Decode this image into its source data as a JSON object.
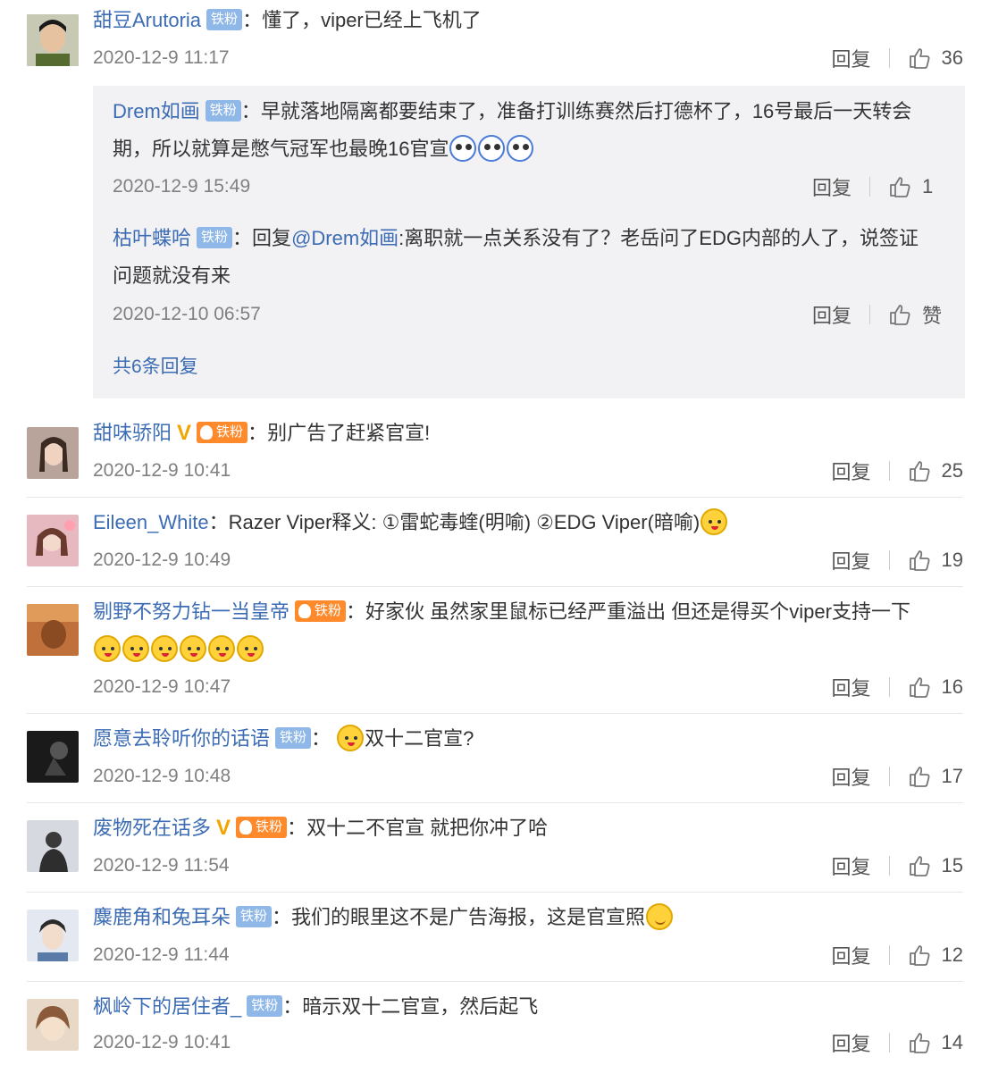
{
  "comments": [
    {
      "username": "甜豆Arutoria",
      "badge": "铁粉",
      "text": "懂了，viper已经上飞机了",
      "time": "2020-12-9 11:17",
      "reply_label": "回复",
      "likes": "36",
      "avatar_color": "#6b7a4a",
      "replies": [
        {
          "username": "Drem如画",
          "badge": "铁粉",
          "text_line1": "早就落地隔离都要结束了，准备打训练赛然后打德杯了，16号最后一天转会",
          "text_line2": "期，所以就算是憋气冠军也最晚16官宣",
          "time": "2020-12-9 15:49",
          "reply_label": "回复",
          "likes": "1"
        },
        {
          "username": "枯叶蝶哈",
          "badge": "铁粉",
          "reply_prefix": "回复",
          "mention": "@Drem如画",
          "text_line1": ":离职就一点关系没有了？老岳问了EDG内部的人了，说签证",
          "text_line2": "问题就没有来",
          "time": "2020-12-10 06:57",
          "reply_label": "回复",
          "likes": "赞"
        }
      ],
      "more_replies": "共6条回复"
    },
    {
      "username": "甜味骄阳",
      "badge": "铁粉",
      "text": "别广告了赶紧官宣!",
      "time": "2020-12-9 10:41",
      "reply_label": "回复",
      "likes": "25",
      "avatar_color": "#8a6a6a"
    },
    {
      "username": "Eileen_White",
      "text": "Razer Viper释义: ①雷蛇毒蝰(明喻) ②EDG Viper(暗喻)",
      "time": "2020-12-9 10:49",
      "reply_label": "回复",
      "likes": "19",
      "avatar_color": "#c07a80"
    },
    {
      "username": "剔野不努力钻一当皇帝",
      "badge": "铁粉",
      "text": "好家伙 虽然家里鼠标已经严重溢出 但还是得买个viper支持一下",
      "time": "2020-12-9 10:47",
      "reply_label": "回复",
      "likes": "16",
      "avatar_color": "#c0703a"
    },
    {
      "username": "愿意去聆听你的话语",
      "badge": "铁粉",
      "text": "双十二官宣?",
      "time": "2020-12-9 10:48",
      "reply_label": "回复",
      "likes": "17",
      "avatar_color": "#2a2a2a"
    },
    {
      "username": "废物死在话多",
      "badge": "铁粉",
      "text": "双十二不官宣 就把你冲了哈",
      "time": "2020-12-9 11:54",
      "reply_label": "回复",
      "likes": "15",
      "avatar_color": "#7a7f88"
    },
    {
      "username": "麋鹿角和兔耳朵",
      "badge": "铁粉",
      "text": "我们的眼里这不是广告海报，这是官宣照",
      "time": "2020-12-9 11:44",
      "reply_label": "回复",
      "likes": "12",
      "avatar_color": "#9aa8c0"
    },
    {
      "username": "枫岭下的居住者_",
      "badge": "铁粉",
      "text": "暗示双十二官宣，然后起飞",
      "time": "2020-12-9 10:41",
      "reply_label": "回复",
      "likes": "14",
      "avatar_color": "#c8a080"
    }
  ]
}
